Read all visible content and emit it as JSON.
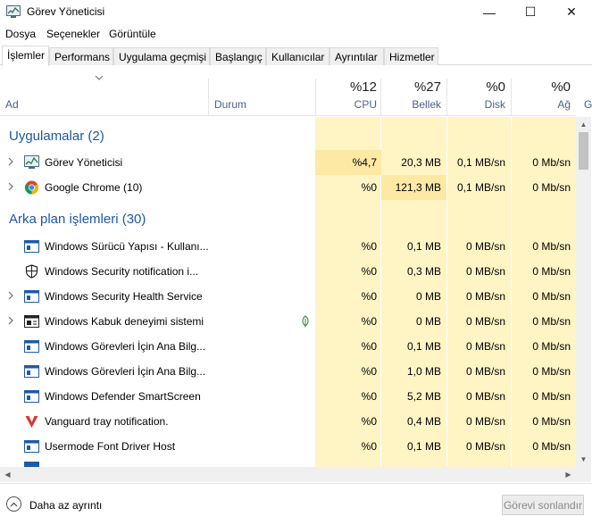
{
  "window": {
    "title": "Görev Yöneticisi",
    "minimize": "—",
    "maximize": "☐",
    "close": "✕"
  },
  "menu": [
    "Dosya",
    "Seçenekler",
    "Görüntüle"
  ],
  "tabs": [
    "İşlemler",
    "Performans",
    "Uygulama geçmişi",
    "Başlangıç",
    "Kullanıcılar",
    "Ayrıntılar",
    "Hizmetler"
  ],
  "active_tab": "İşlemler",
  "columns": {
    "name": "Ad",
    "status": "Durum",
    "cpu": {
      "pct": "%12",
      "label": "CPU"
    },
    "memory": {
      "pct": "%27",
      "label": "Bellek"
    },
    "disk": {
      "pct": "%0",
      "label": "Disk"
    },
    "network": {
      "pct": "%0",
      "label": "Ağ"
    },
    "next_partial": "G"
  },
  "groups": {
    "apps": "Uygulamalar (2)",
    "background": "Arka plan işlemleri (30)"
  },
  "apps": [
    {
      "name": "Görev Yöneticisi",
      "icon": "task-manager-icon",
      "cpu": "%4,7",
      "memory": "20,3 MB",
      "disk": "0,1 MB/sn",
      "network": "0 Mb/sn"
    },
    {
      "name": "Google Chrome (10)",
      "icon": "chrome-icon",
      "cpu": "%0",
      "memory": "121,3 MB",
      "disk": "0,1 MB/sn",
      "network": "0 Mb/sn"
    }
  ],
  "background": [
    {
      "name": "Windows Sürücü Yapısı - Kullanı...",
      "icon": "service-window-icon",
      "expand": false,
      "cpu": "%0",
      "memory": "0,1 MB",
      "disk": "0 MB/sn",
      "network": "0 Mb/sn"
    },
    {
      "name": "Windows Security notification i...",
      "icon": "shield-icon",
      "expand": false,
      "cpu": "%0",
      "memory": "0,3 MB",
      "disk": "0 MB/sn",
      "network": "0 Mb/sn"
    },
    {
      "name": "Windows Security Health Service",
      "icon": "service-window-icon",
      "expand": true,
      "cpu": "%0",
      "memory": "0 MB",
      "disk": "0 MB/sn",
      "network": "0 Mb/sn"
    },
    {
      "name": "Windows Kabuk deneyimi sistemi",
      "icon": "shell-window-icon",
      "expand": true,
      "leaf": true,
      "cpu": "%0",
      "memory": "0 MB",
      "disk": "0 MB/sn",
      "network": "0 Mb/sn"
    },
    {
      "name": "Windows Görevleri İçin Ana Bilg...",
      "icon": "service-window-icon",
      "expand": false,
      "cpu": "%0",
      "memory": "0,1 MB",
      "disk": "0 MB/sn",
      "network": "0 Mb/sn"
    },
    {
      "name": "Windows Görevleri İçin Ana Bilg...",
      "icon": "service-window-icon",
      "expand": false,
      "cpu": "%0",
      "memory": "1,0 MB",
      "disk": "0 MB/sn",
      "network": "0 Mb/sn"
    },
    {
      "name": "Windows Defender SmartScreen",
      "icon": "service-window-icon",
      "expand": false,
      "cpu": "%0",
      "memory": "5,2 MB",
      "disk": "0 MB/sn",
      "network": "0 Mb/sn"
    },
    {
      "name": "Vanguard tray notification.",
      "icon": "vanguard-icon",
      "expand": false,
      "cpu": "%0",
      "memory": "0,4 MB",
      "disk": "0 MB/sn",
      "network": "0 Mb/sn"
    },
    {
      "name": "Usermode Font Driver Host",
      "icon": "service-window-icon",
      "expand": false,
      "cpu": "%0",
      "memory": "0,1 MB",
      "disk": "0 MB/sn",
      "network": "0 Mb/sn"
    }
  ],
  "footer": {
    "fewer_details": "Daha az ayrıntı",
    "end_task": "Görevi sonlandır"
  }
}
